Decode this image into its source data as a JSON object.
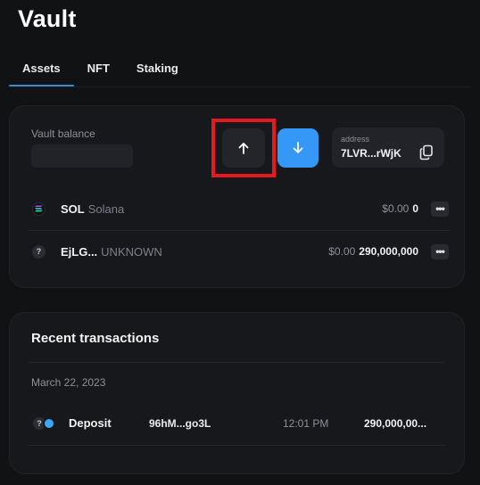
{
  "page": {
    "title": "Vault"
  },
  "tabs": [
    {
      "label": "Assets",
      "active": true
    },
    {
      "label": "NFT",
      "active": false
    },
    {
      "label": "Staking",
      "active": false
    }
  ],
  "vault": {
    "balance_label": "Vault balance",
    "address_label": "address",
    "address_value": "7LVR...rWjK"
  },
  "assets": [
    {
      "symbol": "SOL",
      "name": "Solana",
      "usd": "$0.00",
      "amount": "0",
      "icon": "solana-icon"
    },
    {
      "symbol": "EjLG...",
      "name": "UNKNOWN",
      "usd": "$0.00",
      "amount": "290,000,000",
      "icon": "unknown-token-icon",
      "icon_glyph": "?"
    }
  ],
  "recent": {
    "title": "Recent transactions",
    "date": "March 22, 2023",
    "transactions": [
      {
        "type": "Deposit",
        "address": "96hM...go3L",
        "time": "12:01 PM",
        "amount": "290,000,00...",
        "icon_glyph": "?"
      }
    ]
  },
  "colors": {
    "background": "#111214",
    "card": "#17181b",
    "accent_blue": "#3598f6",
    "tab_underline": "#3a87d8",
    "highlight_red": "#e5191f"
  }
}
